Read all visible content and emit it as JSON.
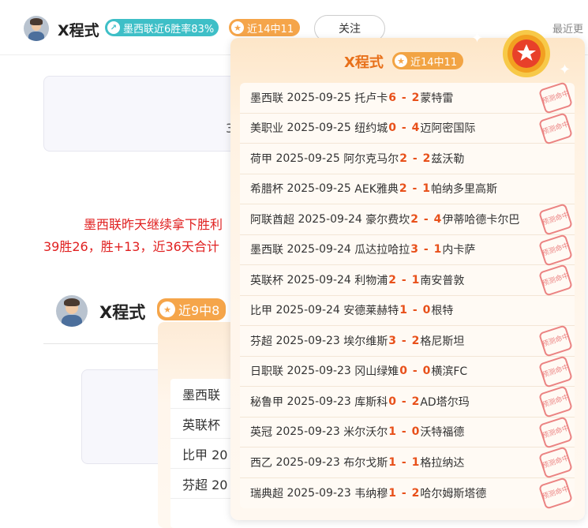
{
  "header": {
    "username": "X程式",
    "win_rate_badge": "墨西联近6胜率83%",
    "streak_badge": "近14中11",
    "follow_label": "关注",
    "recent_label": "最近更"
  },
  "background": {
    "red_line_1": "墨西联昨天继续拿下胜利",
    "red_line_2": "39胜26，胜+13，近36天合计",
    "card_char": "3",
    "user2_name": "X程式",
    "user2_badge": "近9中8",
    "sub_rows": [
      "墨西联",
      "英联杯",
      "比甲 20",
      "芬超 20"
    ]
  },
  "popup": {
    "title": "X程式",
    "streak_badge": "近14中11",
    "stamp_label": "预测命中",
    "matches": [
      {
        "league": "墨西联",
        "date": "2025-09-25",
        "home": "托卢卡",
        "hs": "6",
        "as": "2",
        "away": "蒙特雷",
        "hit": true
      },
      {
        "league": "美职业",
        "date": "2025-09-25",
        "home": "纽约城",
        "hs": "0",
        "as": "4",
        "away": "迈阿密国际",
        "hit": true
      },
      {
        "league": "荷甲",
        "date": "2025-09-25",
        "home": "阿尔克马尔",
        "hs": "2",
        "as": "2",
        "away": "兹沃勒",
        "hit": false
      },
      {
        "league": "希腊杯",
        "date": "2025-09-25",
        "home": "AEK雅典",
        "hs": "2",
        "as": "1",
        "away": "帕纳多里高斯",
        "hit": false
      },
      {
        "league": "阿联酋超",
        "date": "2025-09-24",
        "home": "豪尔费坎",
        "hs": "2",
        "as": "4",
        "away": "伊蒂哈德卡尔巴",
        "hit": true
      },
      {
        "league": "墨西联",
        "date": "2025-09-24",
        "home": "瓜达拉哈拉",
        "hs": "3",
        "as": "1",
        "away": "内卡萨",
        "hit": true
      },
      {
        "league": "英联杯",
        "date": "2025-09-24",
        "home": "利物浦",
        "hs": "2",
        "as": "1",
        "away": "南安普敦",
        "hit": true
      },
      {
        "league": "比甲",
        "date": "2025-09-24",
        "home": "安德莱赫特",
        "hs": "1",
        "as": "0",
        "away": "根特",
        "hit": false
      },
      {
        "league": "芬超",
        "date": "2025-09-23",
        "home": "埃尔维斯",
        "hs": "3",
        "as": "2",
        "away": "格尼斯坦",
        "hit": true
      },
      {
        "league": "日职联",
        "date": "2025-09-23",
        "home": "冈山绿雉",
        "hs": "0",
        "as": "0",
        "away": "横滨FC",
        "hit": true
      },
      {
        "league": "秘鲁甲",
        "date": "2025-09-23",
        "home": "库斯科",
        "hs": "0",
        "as": "2",
        "away": "AD塔尔玛",
        "hit": true
      },
      {
        "league": "英冠",
        "date": "2025-09-23",
        "home": "米尔沃尔",
        "hs": "1",
        "as": "0",
        "away": "沃特福德",
        "hit": true
      },
      {
        "league": "西乙",
        "date": "2025-09-23",
        "home": "布尔戈斯",
        "hs": "1",
        "as": "1",
        "away": "格拉纳达",
        "hit": true
      },
      {
        "league": "瑞典超",
        "date": "2025-09-23",
        "home": "韦纳穆",
        "hs": "1",
        "as": "2",
        "away": "哈尔姆斯塔德",
        "hit": true
      }
    ]
  },
  "colors": {
    "accent_orange": "#e8701a",
    "score_red": "#e8501a",
    "teal": "#3ebfc7",
    "stamp": "#e86f6f",
    "text_red": "#e02020"
  }
}
